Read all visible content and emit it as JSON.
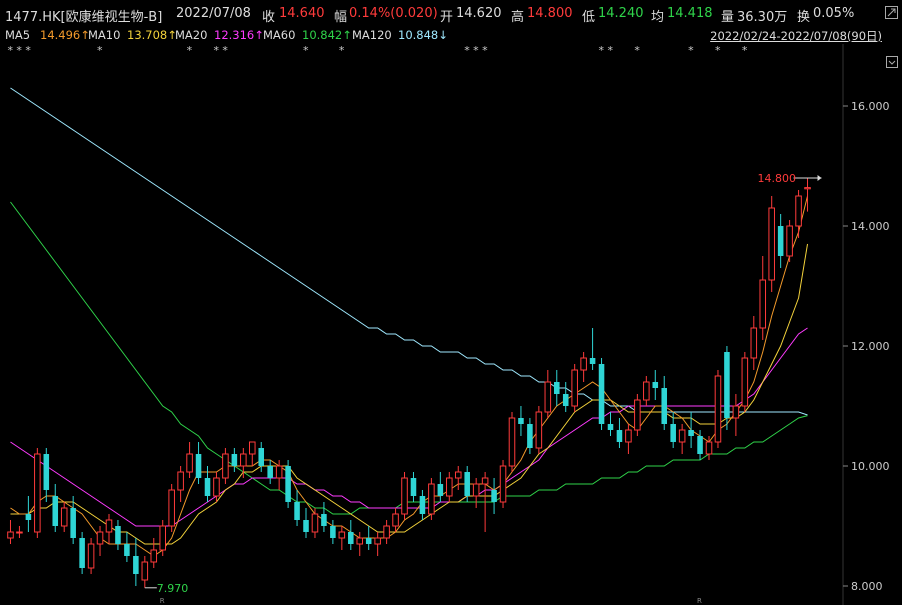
{
  "header": {
    "code": "1477.HK[欧康维视生物-B]",
    "date": "2022/07/08",
    "close_label": "收",
    "close": "14.640",
    "change_label": "幅",
    "change": "0.14%(0.020)",
    "open_label": "开",
    "open": "14.620",
    "high_label": "高",
    "high": "14.800",
    "low_label": "低",
    "low": "14.240",
    "avg_label": "均",
    "avg": "14.418",
    "vol_label": "量",
    "vol": "36.30万",
    "turnover_label": "换",
    "turnover": "0.05%"
  },
  "ma_legend": [
    {
      "label": "MA5",
      "value": "14.496↑",
      "color": "#f39a2b"
    },
    {
      "label": "MA10",
      "value": "13.708↑",
      "color": "#f3d23b"
    },
    {
      "label": "MA20",
      "value": "12.316↑",
      "color": "#ff3bff"
    },
    {
      "label": "MA60",
      "value": "10.842↑",
      "color": "#2fd34a"
    },
    {
      "label": "MA120",
      "value": "10.848↓",
      "color": "#9fe9ff"
    }
  ],
  "date_range": "2022/02/24-2022/07/08(90日)",
  "chart_data": {
    "type": "candlestick",
    "ylim": [
      7.9,
      16.8
    ],
    "yticks": [
      "8.000",
      "10.000",
      "12.000",
      "14.000",
      "16.000"
    ],
    "max_label": "14.800",
    "min_label": "7.970",
    "marker_r": "R",
    "up_color": "#ff3b3b",
    "down_color": "#2fd5d5",
    "candles": [
      [
        8.8,
        9.1,
        8.7,
        8.9
      ],
      [
        8.9,
        9.0,
        8.8,
        8.9
      ],
      [
        9.2,
        9.5,
        8.9,
        9.1
      ],
      [
        8.9,
        10.3,
        8.8,
        10.2
      ],
      [
        10.2,
        10.3,
        9.4,
        9.6
      ],
      [
        9.5,
        9.7,
        8.9,
        9.0
      ],
      [
        9.0,
        9.4,
        8.9,
        9.3
      ],
      [
        9.3,
        9.5,
        8.7,
        8.8
      ],
      [
        8.8,
        8.9,
        8.2,
        8.3
      ],
      [
        8.3,
        8.8,
        8.2,
        8.7
      ],
      [
        8.7,
        9.0,
        8.5,
        8.9
      ],
      [
        8.9,
        9.2,
        8.7,
        9.1
      ],
      [
        9.0,
        9.1,
        8.6,
        8.7
      ],
      [
        8.7,
        8.9,
        8.4,
        8.5
      ],
      [
        8.5,
        8.8,
        8.0,
        8.2
      ],
      [
        8.1,
        8.5,
        7.97,
        8.4
      ],
      [
        8.4,
        8.8,
        8.3,
        8.6
      ],
      [
        8.6,
        9.1,
        8.5,
        9.0
      ],
      [
        9.0,
        9.7,
        8.9,
        9.6
      ],
      [
        9.6,
        10.0,
        9.4,
        9.9
      ],
      [
        9.9,
        10.4,
        9.8,
        10.2
      ],
      [
        10.2,
        10.4,
        9.7,
        9.8
      ],
      [
        9.8,
        10.0,
        9.4,
        9.5
      ],
      [
        9.5,
        9.9,
        9.4,
        9.8
      ],
      [
        9.8,
        10.3,
        9.7,
        10.2
      ],
      [
        10.2,
        10.3,
        9.9,
        10.0
      ],
      [
        10.0,
        10.3,
        9.8,
        10.2
      ],
      [
        10.2,
        10.4,
        10.0,
        10.4
      ],
      [
        10.3,
        10.4,
        9.9,
        10.0
      ],
      [
        10.0,
        10.1,
        9.7,
        9.8
      ],
      [
        9.8,
        10.1,
        9.6,
        10.0
      ],
      [
        10.0,
        10.1,
        9.3,
        9.4
      ],
      [
        9.4,
        9.6,
        9.0,
        9.1
      ],
      [
        9.1,
        9.3,
        8.8,
        8.9
      ],
      [
        8.9,
        9.3,
        8.8,
        9.2
      ],
      [
        9.2,
        9.4,
        8.9,
        9.0
      ],
      [
        9.0,
        9.1,
        8.7,
        8.8
      ],
      [
        8.8,
        9.0,
        8.6,
        8.9
      ],
      [
        8.9,
        9.1,
        8.6,
        8.7
      ],
      [
        8.7,
        8.9,
        8.5,
        8.8
      ],
      [
        8.8,
        9.0,
        8.6,
        8.7
      ],
      [
        8.7,
        8.9,
        8.5,
        8.8
      ],
      [
        8.8,
        9.1,
        8.7,
        9.0
      ],
      [
        9.0,
        9.3,
        8.9,
        9.2
      ],
      [
        9.2,
        9.9,
        9.1,
        9.8
      ],
      [
        9.8,
        9.9,
        9.4,
        9.5
      ],
      [
        9.5,
        9.6,
        9.1,
        9.2
      ],
      [
        9.2,
        9.8,
        9.1,
        9.7
      ],
      [
        9.7,
        9.9,
        9.4,
        9.5
      ],
      [
        9.5,
        9.9,
        9.4,
        9.8
      ],
      [
        9.8,
        10.0,
        9.6,
        9.9
      ],
      [
        9.9,
        10.0,
        9.4,
        9.5
      ],
      [
        9.5,
        9.8,
        9.3,
        9.7
      ],
      [
        9.7,
        9.9,
        8.9,
        9.8
      ],
      [
        9.6,
        9.8,
        9.2,
        9.4
      ],
      [
        9.4,
        10.1,
        9.3,
        10.0
      ],
      [
        10.0,
        10.9,
        9.9,
        10.8
      ],
      [
        10.8,
        11.0,
        10.5,
        10.7
      ],
      [
        10.7,
        10.8,
        10.2,
        10.3
      ],
      [
        10.3,
        11.0,
        10.2,
        10.9
      ],
      [
        10.9,
        11.6,
        10.8,
        11.4
      ],
      [
        11.4,
        11.6,
        11.0,
        11.2
      ],
      [
        11.2,
        11.4,
        10.9,
        11.0
      ],
      [
        11.0,
        11.7,
        10.9,
        11.6
      ],
      [
        11.6,
        11.9,
        11.4,
        11.8
      ],
      [
        11.8,
        12.3,
        11.6,
        11.7
      ],
      [
        11.7,
        11.8,
        10.6,
        10.7
      ],
      [
        10.7,
        10.9,
        10.5,
        10.6
      ],
      [
        10.6,
        10.8,
        10.3,
        10.4
      ],
      [
        10.4,
        10.7,
        10.2,
        10.6
      ],
      [
        10.6,
        11.2,
        10.5,
        11.1
      ],
      [
        11.1,
        11.5,
        11.0,
        11.4
      ],
      [
        11.4,
        11.6,
        11.1,
        11.3
      ],
      [
        11.3,
        11.5,
        10.6,
        10.7
      ],
      [
        10.7,
        10.9,
        10.3,
        10.4
      ],
      [
        10.4,
        10.7,
        10.2,
        10.6
      ],
      [
        10.6,
        10.9,
        10.3,
        10.5
      ],
      [
        10.5,
        10.6,
        10.1,
        10.2
      ],
      [
        10.2,
        10.5,
        10.1,
        10.4
      ],
      [
        10.4,
        11.6,
        10.3,
        11.5
      ],
      [
        11.9,
        12.0,
        10.6,
        10.8
      ],
      [
        10.8,
        11.2,
        10.5,
        11.0
      ],
      [
        11.0,
        11.9,
        10.9,
        11.8
      ],
      [
        11.8,
        12.5,
        11.6,
        12.3
      ],
      [
        12.3,
        13.5,
        12.1,
        13.1
      ],
      [
        13.1,
        14.5,
        12.9,
        14.3
      ],
      [
        14.0,
        14.2,
        13.3,
        13.5
      ],
      [
        13.5,
        14.1,
        13.4,
        14.0
      ],
      [
        14.0,
        14.6,
        13.8,
        14.5
      ],
      [
        14.62,
        14.8,
        14.24,
        14.64
      ]
    ],
    "ma5": [
      9.3,
      9.2,
      9.2,
      9.4,
      9.5,
      9.5,
      9.4,
      9.3,
      9.2,
      9.0,
      8.8,
      8.7,
      8.7,
      8.7,
      8.7,
      8.6,
      8.5,
      8.6,
      8.8,
      9.2,
      9.6,
      9.9,
      9.9,
      9.9,
      10.0,
      10.0,
      10.0,
      10.0,
      10.1,
      10.1,
      10.0,
      9.9,
      9.6,
      9.4,
      9.2,
      9.1,
      9.0,
      9.0,
      8.9,
      8.8,
      8.8,
      8.8,
      8.8,
      8.9,
      9.1,
      9.2,
      9.4,
      9.5,
      9.5,
      9.6,
      9.7,
      9.7,
      9.7,
      9.7,
      9.6,
      9.7,
      9.9,
      10.1,
      10.4,
      10.6,
      10.8,
      11.0,
      11.1,
      11.2,
      11.3,
      11.4,
      11.3,
      11.1,
      10.9,
      10.7,
      10.6,
      10.8,
      11.0,
      11.0,
      10.9,
      10.8,
      10.6,
      10.5,
      10.4,
      10.6,
      10.7,
      10.9,
      11.1,
      11.4,
      11.9,
      12.5,
      13.0,
      13.5,
      13.9,
      14.5
    ],
    "ma10": [
      9.2,
      9.2,
      9.2,
      9.3,
      9.3,
      9.4,
      9.4,
      9.4,
      9.3,
      9.2,
      9.1,
      9.0,
      8.9,
      8.9,
      8.8,
      8.7,
      8.7,
      8.7,
      8.7,
      8.8,
      9.0,
      9.2,
      9.3,
      9.4,
      9.6,
      9.7,
      9.9,
      9.9,
      10.0,
      10.0,
      10.0,
      10.0,
      9.8,
      9.7,
      9.6,
      9.5,
      9.4,
      9.3,
      9.2,
      9.1,
      9.0,
      8.9,
      8.9,
      8.9,
      8.9,
      9.0,
      9.1,
      9.2,
      9.3,
      9.4,
      9.4,
      9.5,
      9.5,
      9.5,
      9.5,
      9.6,
      9.7,
      9.8,
      10.0,
      10.2,
      10.3,
      10.5,
      10.7,
      10.9,
      11.0,
      11.1,
      11.1,
      11.1,
      11.0,
      10.9,
      10.9,
      10.9,
      10.9,
      10.9,
      10.8,
      10.8,
      10.8,
      10.7,
      10.7,
      10.7,
      10.8,
      10.8,
      10.9,
      11.1,
      11.4,
      11.7,
      12.0,
      12.4,
      12.8,
      13.7
    ],
    "ma20": [
      10.4,
      10.3,
      10.2,
      10.1,
      10.0,
      9.9,
      9.8,
      9.7,
      9.6,
      9.5,
      9.4,
      9.3,
      9.2,
      9.1,
      9.0,
      9.0,
      9.0,
      9.0,
      9.0,
      9.1,
      9.2,
      9.3,
      9.4,
      9.5,
      9.6,
      9.7,
      9.7,
      9.8,
      9.8,
      9.8,
      9.8,
      9.8,
      9.7,
      9.7,
      9.6,
      9.6,
      9.5,
      9.5,
      9.4,
      9.4,
      9.3,
      9.3,
      9.3,
      9.3,
      9.3,
      9.3,
      9.3,
      9.3,
      9.4,
      9.4,
      9.4,
      9.5,
      9.5,
      9.6,
      9.6,
      9.7,
      9.8,
      9.9,
      10.0,
      10.1,
      10.3,
      10.4,
      10.5,
      10.6,
      10.7,
      10.8,
      10.8,
      10.9,
      10.9,
      11.0,
      11.0,
      11.0,
      11.0,
      11.0,
      11.0,
      11.0,
      11.0,
      11.0,
      11.0,
      11.0,
      11.0,
      11.0,
      11.1,
      11.2,
      11.4,
      11.6,
      11.8,
      12.0,
      12.2,
      12.3
    ],
    "ma60": [
      14.4,
      14.2,
      14.0,
      13.8,
      13.6,
      13.4,
      13.2,
      13.0,
      12.8,
      12.6,
      12.4,
      12.2,
      12.0,
      11.8,
      11.6,
      11.4,
      11.2,
      11.0,
      10.9,
      10.7,
      10.6,
      10.5,
      10.3,
      10.2,
      10.1,
      10.0,
      9.9,
      9.8,
      9.7,
      9.6,
      9.6,
      9.5,
      9.4,
      9.4,
      9.3,
      9.3,
      9.2,
      9.2,
      9.2,
      9.3,
      9.3,
      9.3,
      9.3,
      9.3,
      9.4,
      9.4,
      9.4,
      9.4,
      9.4,
      9.4,
      9.4,
      9.4,
      9.4,
      9.4,
      9.4,
      9.5,
      9.5,
      9.5,
      9.5,
      9.6,
      9.6,
      9.6,
      9.7,
      9.7,
      9.7,
      9.7,
      9.8,
      9.8,
      9.8,
      9.9,
      9.9,
      10.0,
      10.0,
      10.0,
      10.1,
      10.1,
      10.1,
      10.1,
      10.2,
      10.2,
      10.2,
      10.3,
      10.3,
      10.4,
      10.4,
      10.5,
      10.6,
      10.7,
      10.8,
      10.84
    ],
    "ma120": [
      16.3,
      16.2,
      16.1,
      16.0,
      15.9,
      15.8,
      15.7,
      15.6,
      15.5,
      15.4,
      15.3,
      15.2,
      15.1,
      15.0,
      14.9,
      14.8,
      14.7,
      14.6,
      14.5,
      14.4,
      14.3,
      14.2,
      14.1,
      14.0,
      13.9,
      13.8,
      13.7,
      13.6,
      13.5,
      13.4,
      13.3,
      13.2,
      13.1,
      13.0,
      12.9,
      12.8,
      12.7,
      12.6,
      12.5,
      12.4,
      12.3,
      12.3,
      12.2,
      12.2,
      12.1,
      12.1,
      12.0,
      12.0,
      11.9,
      11.9,
      11.9,
      11.8,
      11.8,
      11.7,
      11.7,
      11.6,
      11.6,
      11.5,
      11.5,
      11.4,
      11.4,
      11.3,
      11.3,
      11.2,
      11.2,
      11.1,
      11.1,
      11.0,
      11.0,
      11.0,
      10.9,
      10.9,
      10.9,
      10.9,
      10.9,
      10.9,
      10.9,
      10.9,
      10.9,
      10.9,
      10.9,
      10.9,
      10.9,
      10.9,
      10.9,
      10.9,
      10.9,
      10.9,
      10.9,
      10.85
    ],
    "stars_at": [
      0,
      1,
      2,
      10,
      20,
      23,
      24,
      33,
      37,
      51,
      52,
      53,
      66,
      67,
      70,
      76,
      79,
      82
    ],
    "r_at": [
      17,
      77
    ]
  }
}
